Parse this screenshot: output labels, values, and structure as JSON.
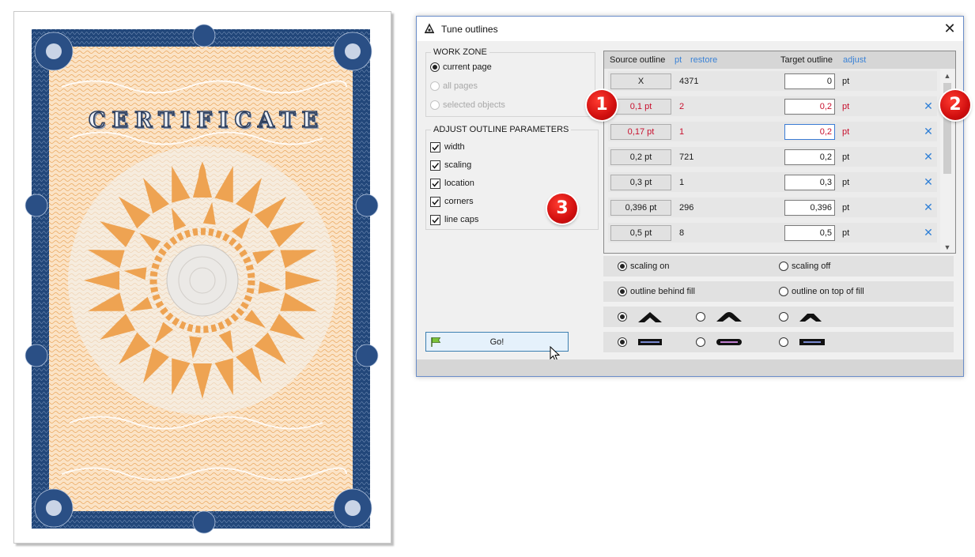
{
  "certificate": {
    "title": "CERTIFICATE"
  },
  "dialog": {
    "title": "Tune outlines",
    "work_zone": {
      "legend": "WORK ZONE",
      "options": [
        "current page",
        "all pages",
        "selected objects"
      ]
    },
    "adjust_params": {
      "legend": "ADJUST OUTLINE PARAMETERS",
      "items": [
        "width",
        "scaling",
        "location",
        "corners",
        "line caps"
      ]
    },
    "go_label": "Go!",
    "grid": {
      "headers": {
        "source": "Source outline",
        "pt_link": "pt",
        "restore_link": "restore",
        "target": "Target outline",
        "adjust_link": "adjust"
      },
      "rows": [
        {
          "source": "X",
          "count": "4371",
          "target": "0",
          "unit": "pt"
        },
        {
          "source": "0,1 pt",
          "count": "2",
          "target": "0,2",
          "unit": "pt"
        },
        {
          "source": "0,17 pt",
          "count": "1",
          "target": "0,2",
          "unit": "pt"
        },
        {
          "source": "0,2 pt",
          "count": "721",
          "target": "0,2",
          "unit": "pt"
        },
        {
          "source": "0,3 pt",
          "count": "1",
          "target": "0,3",
          "unit": "pt"
        },
        {
          "source": "0,396 pt",
          "count": "296",
          "target": "0,396",
          "unit": "pt"
        },
        {
          "source": "0,5 pt",
          "count": "8",
          "target": "0,5",
          "unit": "pt"
        }
      ],
      "remove_glyph": "✕"
    },
    "scaling": {
      "on": "scaling on",
      "off": "scaling off"
    },
    "outline_order": {
      "behind": "outline behind fill",
      "top": "outline on top of fill"
    }
  },
  "badges": [
    "1",
    "2",
    "3"
  ],
  "colors": {
    "accent_red": "#c8102e",
    "link_blue": "#3a82d6",
    "cert_blue": "#1e3f6e",
    "cert_orange": "#f0a04b"
  }
}
